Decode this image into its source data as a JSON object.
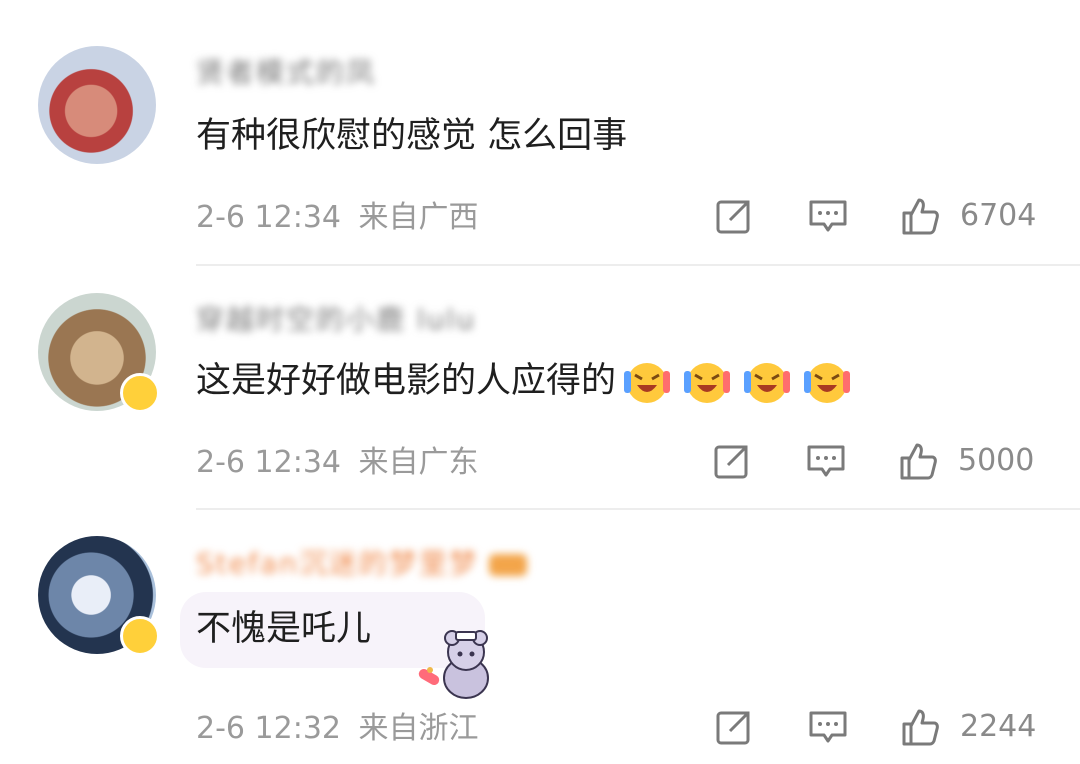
{
  "comments": [
    {
      "username": "贤者模式的凤",
      "text": "有种很欣慰的感觉 怎么回事",
      "time": "2-6 12:34",
      "location": "来自广西",
      "likes": "6704",
      "icons": [
        "share-icon",
        "comment-icon",
        "like-icon"
      ]
    },
    {
      "username": "穿越时空的小鹿 lulu",
      "text": "这是好好做电影的人应得的",
      "emojis": [
        "laughing-cry-emoji",
        "laughing-cry-emoji",
        "laughing-cry-emoji",
        "laughing-cry-emoji"
      ],
      "time": "2-6 12:34",
      "location": "来自广东",
      "likes": "5000",
      "icons": [
        "share-icon",
        "comment-icon",
        "like-icon"
      ]
    },
    {
      "username": "Stefan沉迷的梦里梦",
      "text": "不愧是吒儿",
      "sticker": "bear-nurse-sticker",
      "time": "2-6 12:32",
      "location": "来自浙江",
      "likes": "2244",
      "icons": [
        "share-icon",
        "comment-icon",
        "like-icon"
      ]
    }
  ],
  "colors": {
    "text": "#1f1f1f",
    "meta": "#9a9a9a",
    "username_orange": "#f08a4b",
    "divider": "#ededed"
  }
}
